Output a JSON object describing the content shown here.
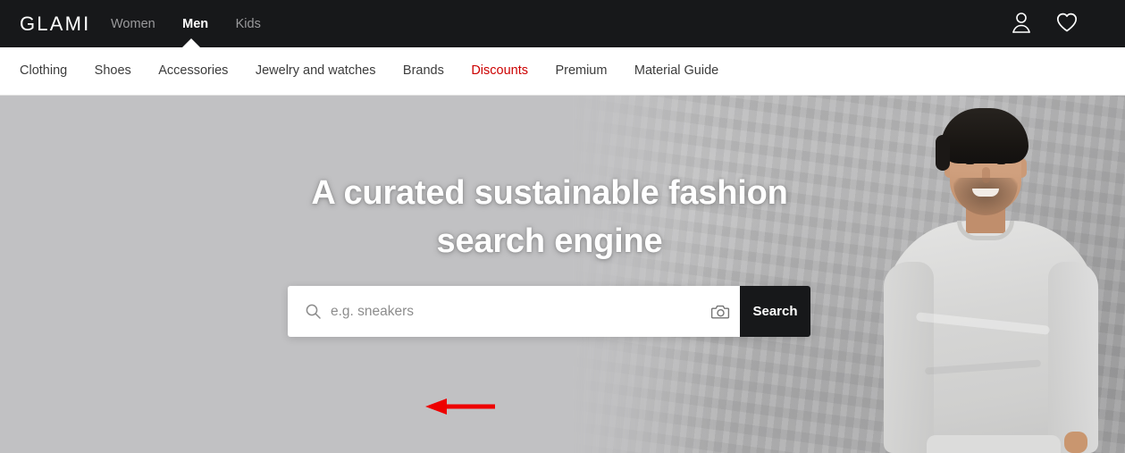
{
  "site": {
    "logo_text": "GLAMI",
    "accent_sale_color": "#cc0000",
    "header_bg": "#17181a"
  },
  "topbar": {
    "tabs": [
      {
        "label": "Women",
        "active": false
      },
      {
        "label": "Men",
        "active": true
      },
      {
        "label": "Kids",
        "active": false
      }
    ],
    "icons": [
      {
        "name": "user-account-icon",
        "label": "Account"
      },
      {
        "name": "heart-favorites-icon",
        "label": "Favorites"
      }
    ]
  },
  "catnav": {
    "items": [
      {
        "label": "Clothing",
        "highlight": false
      },
      {
        "label": "Shoes",
        "highlight": false
      },
      {
        "label": "Accessories",
        "highlight": false
      },
      {
        "label": "Jewelry and watches",
        "highlight": false
      },
      {
        "label": "Brands",
        "highlight": false
      },
      {
        "label": "Discounts",
        "highlight": true
      },
      {
        "label": "Premium",
        "highlight": false
      },
      {
        "label": "Material Guide",
        "highlight": false
      }
    ]
  },
  "hero": {
    "headline_line1": "A curated sustainable fashion",
    "headline_line2": "search engine",
    "image_alt": "Smiling man in grey sweatshirt against concrete wall"
  },
  "search": {
    "placeholder": "e.g. sneakers",
    "value": "",
    "button_label": "Search",
    "magnifier_icon": "search-icon",
    "camera_icon": "camera-visual-search-icon"
  },
  "annotation": {
    "arrow_color": "#ee0000",
    "points_to": "search-input"
  }
}
